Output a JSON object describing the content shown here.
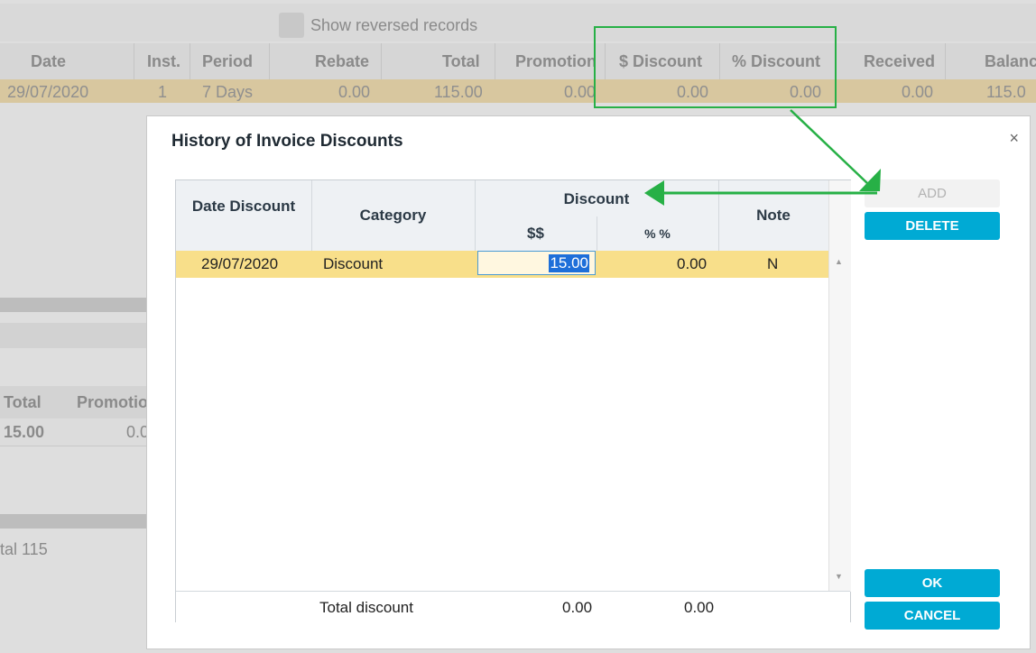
{
  "background": {
    "show_reversed_label": "Show reversed records",
    "columns": [
      "Date",
      "Inst.",
      "Period",
      "Rebate",
      "Total",
      "Promotion",
      "$ Discount",
      "% Discount",
      "Received",
      "Balanc"
    ],
    "row": [
      "29/07/2020",
      "1",
      "7 Days",
      "0.00",
      "115.00",
      "0.00",
      "0.00",
      "0.00",
      "0.00",
      "115.0"
    ],
    "sub_columns": [
      "Total",
      "Promotio"
    ],
    "sub_row": [
      "15.00",
      "0.0"
    ],
    "total_text": "tal 115"
  },
  "dialog": {
    "title": "History of Invoice Discounts",
    "close_icon": "×",
    "columns": {
      "date_discount": "Date Discount",
      "category": "Category",
      "discount": "Discount",
      "dollar": "$$",
      "percent": "% %",
      "note": "Note"
    },
    "rows": [
      {
        "date": "29/07/2020",
        "category": "Discount",
        "dollar": "15.00",
        "percent": "0.00",
        "note": "N"
      }
    ],
    "footer": {
      "label": "Total discount",
      "dollar_total": "0.00",
      "percent_total": "0.00"
    },
    "buttons": {
      "add": "ADD",
      "delete": "DELETE",
      "ok": "OK",
      "cancel": "CANCEL"
    }
  },
  "colors": {
    "accent": "#00aad4",
    "row_highlight": "#f8df8a",
    "annotation": "#27b046"
  }
}
